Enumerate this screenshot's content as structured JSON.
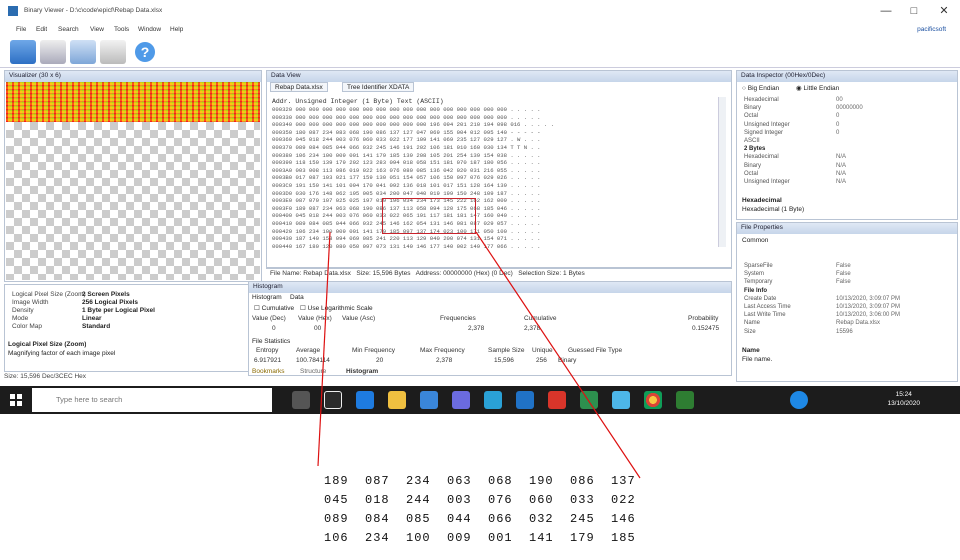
{
  "window": {
    "title": "Binary Viewer - D:\\c\\code\\epicf\\Rebap Data.xlsx",
    "account": "pacificsoft",
    "controls": [
      "—",
      "□",
      "✕"
    ]
  },
  "menu": [
    "File",
    "Edit",
    "Search",
    "View",
    "Tools",
    "Window",
    "Help"
  ],
  "toolbar": [
    "open-icon",
    "print-icon",
    "preview-icon",
    "tools-icon",
    "help-icon"
  ],
  "visualizer": {
    "title": "Visualizer (30 x 6)",
    "props": [
      {
        "k": "Logical Pixel Size (Zoom)",
        "v": "2 Screen Pixels"
      },
      {
        "k": "Image Width",
        "v": "256 Logical Pixels"
      },
      {
        "k": "Density",
        "v": "1 Byte per Logical Pixel"
      },
      {
        "k": "Mode",
        "v": "Linear"
      },
      {
        "k": "Color Map",
        "v": "Standard"
      }
    ],
    "help_title": "Logical Pixel Size (Zoom)",
    "help_text": "Magnifying factor of each image pixel",
    "status": "Size: 15,596 Dec/3CEC Hex"
  },
  "dataview": {
    "title": "Data View",
    "tabs": [
      "Rebap Data.xlsx",
      "Tree Identifier XDATA"
    ],
    "header": "Addr.     Unsigned Integer (1 Byte)                                           Text (ASCII)",
    "rows": [
      "000320 000 000 000 000 000 000 000 000 000 000 000 000 000 000 000 000  . . . . .",
      "000330 000 000 000 000 000 000 000 000 000 000 000 000 000 000 000 000  . . . . .",
      "000340 000 000 000 000 000 000 000 000 000 000 196 094 201 210 194 098 016  . . . . .",
      "000350 180 087 234 083 068 190 086 137 127 047 069 155 004 012 095 140  - - - - -",
      "000360 045 018 244 003 076 060 033 022 177 109 141 069 235 127 029 127  . W . . .",
      "000370 089 084 085 044 066 032 245 146 191 202 106 181 010 160 030 134  T T N . .",
      "000380 106 234 100 009 001 141 179 185 139 208 105 201 254 139 154 038  . . . . .",
      "000390 118 150 139 179 202 123 283 094 018 058 151 181 070 187 180 056  . . . . .",
      "0003A0 003 008 113 086 019 022 163 076 080 085 136 042 020 031 216 055  . . . . .",
      "0003B0 017 087 103 021 177 159 130 051 154 057 106 150 097 076 029 026  . . . . .",
      "0003C0 191 150 141 101 094 170 041 092 136 018 101 017 151 128 164 139  . . . . .",
      "0003D0 030 176 148 062 195 005 034 200 047 040 019 199 150 248 109 187  . . . . .",
      "0003E0 087 070 107 025 025 197 019 196 034 234 173 145 222 162 162 009  . . . . .",
      "0003F0 189 087 234 063 068 190 086 137 113 058 094 120 175 068 185 046  . . . . .",
      "000400 045 018 244 003 076 060 033 022 065 191 117 181 181 147 160 040  . . . . .",
      "000410 089 084 085 044 066 032 245 146 162 054 131 146 081 087 029 057  . . . . .",
      "000420 106 234 100 009 001 141 179 185 097 137 174 023 100 171 050 100  . . . . .",
      "000430 187 140 158 094 069 085 241 220 113 129 040 200 074 131 154 071  . . . . .",
      "000440 167 180 120 080 050 097 073 131 140 146 177 140 002 149 177 066  . . . . ."
    ],
    "status": {
      "file": "File Name: Rebap Data.xlsx",
      "size": "Size: 15,596 Bytes",
      "address": "Address: 00000000 (Hex) (0 Dec)",
      "selection": "Selection Size: 1 Bytes"
    }
  },
  "histogram": {
    "title": "Histogram",
    "tabs": [
      "Histogram",
      "Data"
    ],
    "options": [
      "Cumulative",
      "Use Logarithmic Scale"
    ],
    "headers": [
      "Value (Dec)",
      "Value (Hex)",
      "Value (Asc)",
      "Frequencies",
      "Cumulative",
      "Probability"
    ],
    "row": [
      "0",
      "00",
      "",
      "2,378",
      "2,378",
      "0.152475"
    ],
    "stats_title": "File Statistics",
    "stats_headers": [
      "Entropy",
      "Average",
      "Min Frequency",
      "Max Frequency",
      "Sample Size",
      "Unique",
      "Guessed File Type"
    ],
    "stats_row": [
      "6.917921",
      "100.784114",
      "20",
      "2,378",
      "15,596",
      "256",
      "Binary"
    ],
    "bottom_tabs": [
      "Bookmarks",
      "Structure",
      "Histogram"
    ]
  },
  "inspector": {
    "title": "Data Inspector (00Hex/0Dec)",
    "endian": [
      "Big Endian",
      "Little Endian"
    ],
    "rows": [
      {
        "k": "Hexadecimal",
        "v": "00"
      },
      {
        "k": "Binary",
        "v": "00000000"
      },
      {
        "k": "Octal",
        "v": "0"
      },
      {
        "k": "Unsigned Integer",
        "v": "0"
      },
      {
        "k": "Signed Integer",
        "v": "0"
      },
      {
        "k": "ASCII",
        "v": ""
      },
      {
        "k": "2 Bytes",
        "v": ""
      },
      {
        "k": "Hexadecimal",
        "v": "N/A"
      },
      {
        "k": "Binary",
        "v": "N/A"
      },
      {
        "k": "Octal",
        "v": "N/A"
      },
      {
        "k": "Unsigned Integer",
        "v": "N/A"
      }
    ],
    "foot_title": "Hexadecimal",
    "foot_text": "Hexadecimal (1 Byte)"
  },
  "fileprops": {
    "title": "File Properties",
    "category": "Common",
    "rows": [
      {
        "k": "SparseFile",
        "v": "False"
      },
      {
        "k": "System",
        "v": "False"
      },
      {
        "k": "Temporary",
        "v": "False"
      },
      {
        "k": "File Info",
        "v": ""
      },
      {
        "k": "Create Date",
        "v": "10/13/2020, 3:09:07 PM"
      },
      {
        "k": "Last Access Time",
        "v": "10/13/2020, 3:09:07 PM"
      },
      {
        "k": "Last Write Time",
        "v": "10/13/2020, 3:06:00 PM"
      },
      {
        "k": "Name",
        "v": "Rebap Data.xlsx"
      },
      {
        "k": "Size",
        "v": "15596"
      }
    ],
    "foot_title": "Name",
    "foot_text": "File name."
  },
  "taskbar": {
    "search": "Type here to search",
    "time": "15:24",
    "date": "13/10/2020"
  },
  "zoom_rows": [
    "189  087  234  063  068  190  086  137",
    "045  018  244  003  076  060  033  022",
    "089  084  085  044  066  032  245  146",
    "106  234  100  009  001  141  179  185"
  ],
  "colors": {
    "accent": "#c8232c",
    "panel_head": "#c6d5ea",
    "taskbar": "#1c1c1c"
  }
}
